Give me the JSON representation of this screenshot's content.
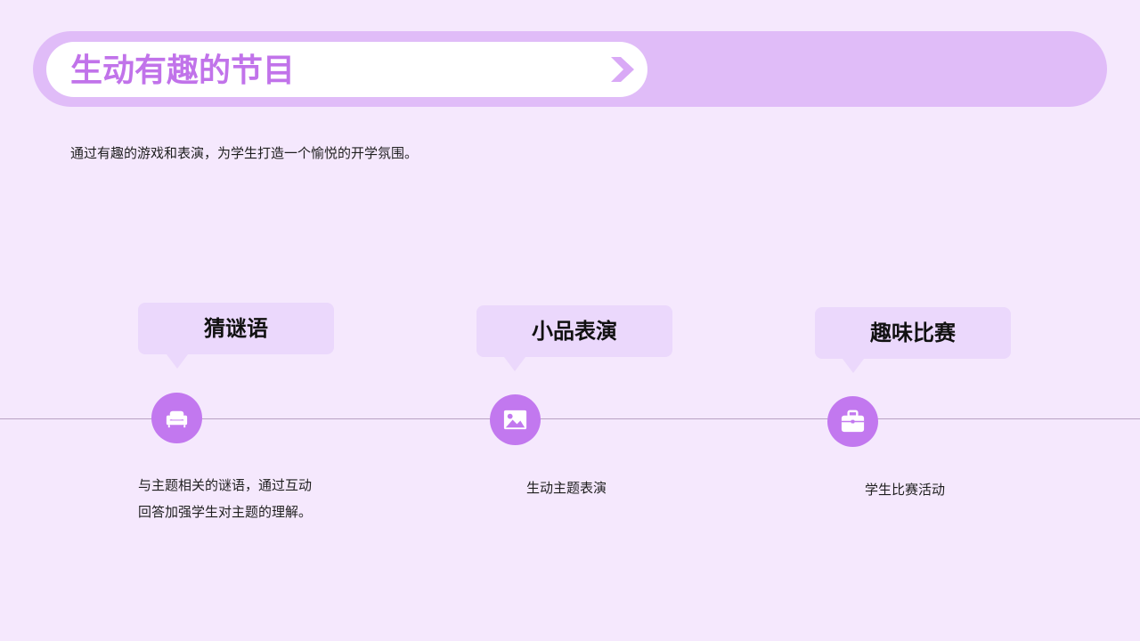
{
  "header": {
    "title": "生动有趣的节目",
    "arrow_icon": "chevron-right-icon"
  },
  "subtitle": "通过有趣的游戏和表演，为学生打造一个愉悦的开学氛围。",
  "colors": {
    "background": "#f5e8fd",
    "header_band": "#e0bcf8",
    "accent": "#c278ef",
    "title_text": "#c173ea",
    "bubble": "#ebd8fc",
    "timeline_line": "#b9a3c4"
  },
  "items": [
    {
      "title": "猜谜语",
      "icon": "sofa-icon",
      "description_lines": [
        "与主题相关的谜语，通过互动",
        "回答加强学生对主题的理解。"
      ]
    },
    {
      "title": "小品表演",
      "icon": "image-icon",
      "description_lines": [
        "生动主题表演"
      ]
    },
    {
      "title": "趣味比赛",
      "icon": "toolbox-icon",
      "description_lines": [
        "学生比赛活动"
      ]
    }
  ]
}
